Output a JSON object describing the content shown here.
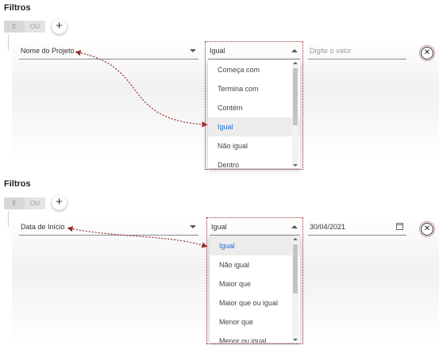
{
  "sections": [
    {
      "title": "Filtros",
      "toggle": {
        "e": "E",
        "ou": "OU"
      },
      "add_label": "+",
      "field": "Nome do Projeto",
      "operator": "Igual",
      "value_placeholder": "Digite o valor",
      "options": [
        "Começa com",
        "Termina com",
        "Contém",
        "Igual",
        "Não igual",
        "Dentro"
      ],
      "selected_index": 3
    },
    {
      "title": "Filtros",
      "toggle": {
        "e": "E",
        "ou": "OU"
      },
      "add_label": "+",
      "field": "Data de Início",
      "operator": "Igual",
      "value": "30/04/2021",
      "options": [
        "Igual",
        "Não igual",
        "Maior que",
        "Maior que ou igual",
        "Menor que",
        "Menor ou igual"
      ],
      "selected_index": 0
    }
  ],
  "close_symbol": "✕",
  "annotation_color": "#9b2a2a",
  "selected_color": "#1f6fc5"
}
